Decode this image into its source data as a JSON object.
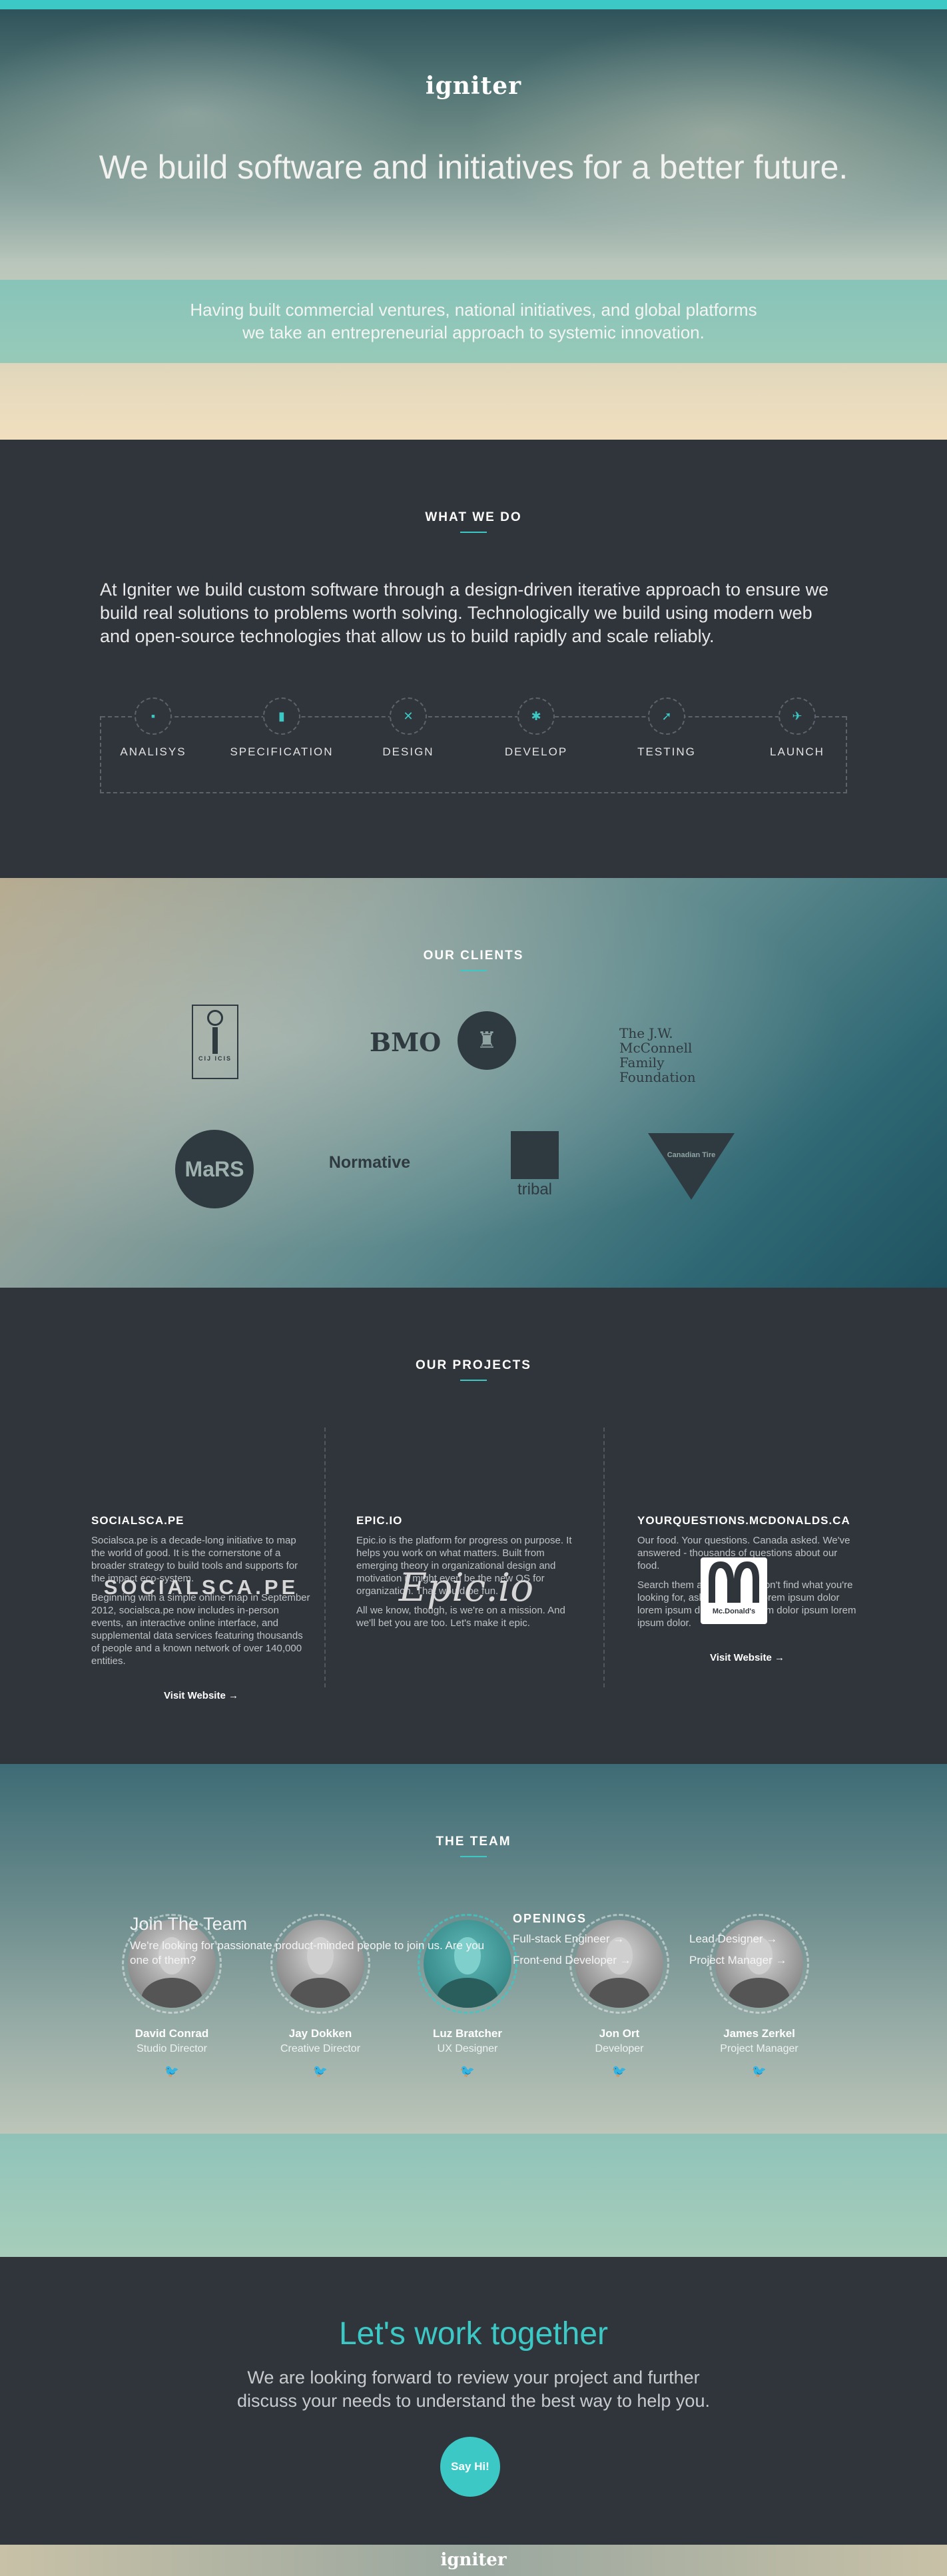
{
  "hero": {
    "logo": "igniter",
    "headline": "We build software and initiatives for a better future.",
    "sub_line1": "Having built commercial ventures, national initiatives, and global platforms",
    "sub_line2": "we take an entrepreneurial approach to systemic innovation."
  },
  "what_we_do": {
    "title": "WHAT WE DO",
    "lead": "At Igniter we build custom software through a design-driven iterative approach to ensure we build real solutions to problems worth solving. Technologically we build using modern web and open-source technologies that allow us to build rapidly and scale reliably.",
    "steps": [
      {
        "label": "ANALISYS",
        "icon": "video-icon"
      },
      {
        "label": "SPECIFICATION",
        "icon": "document-icon"
      },
      {
        "label": "DESIGN",
        "icon": "tools-icon"
      },
      {
        "label": "DEVELOP",
        "icon": "gear-icon"
      },
      {
        "label": "TESTING",
        "icon": "pointer-icon"
      },
      {
        "label": "LAUNCH",
        "icon": "plane-icon"
      }
    ]
  },
  "clients": {
    "title": "OUR CLIENTS",
    "logos": [
      {
        "name": "CIJ ICIS"
      },
      {
        "name": "BMO"
      },
      {
        "name": "The J.W. McConnell Family Foundation"
      },
      {
        "name": "MaRS"
      },
      {
        "name": "Normative"
      },
      {
        "name": "tribal"
      },
      {
        "name": "Canadian Tire"
      }
    ]
  },
  "projects": {
    "title": "OUR PROJECTS",
    "items": [
      {
        "logo": "SOCIALSCA.PE",
        "name": "SOCIALSCA.PE",
        "p1": "Socialsca.pe is a decade-long initiative to map the world of good. It is the cornerstone of a broader strategy to build tools and supports for the impact eco-system.",
        "p2": "Beginning with a simple online map in September 2012, socialsca.pe now includes in-person events, an interactive online interface, and supplemental data services featuring thousands of people and a known network of over 140,000 entities.",
        "link": "Visit Website →"
      },
      {
        "logo": "Epic.io",
        "name": "EPIC.IO",
        "p1": "Epic.io is the platform for progress on purpose. It helps you work on what matters. Built from emerging theory in organizational design and motivation it might even be the new OS for organization. That would be fun.",
        "p2": "All we know, though, is we're on a mission. And we'll bet you are too. Let's make it epic.",
        "link": ""
      },
      {
        "logo": "Mc.Donald's",
        "name": "YOURQUESTIONS.MCDONALDS.CA",
        "p1": "Our food. Your questions. Canada asked. We've answered - thousands of questions about our food.",
        "p2": "Search them all. And if you don't find what you're looking for, ask yours. And Lorem ipsum dolor lorem ipsum dolor lorem ipsum dolor ipsum lorem ipsum dolor.",
        "link": "Visit Website →"
      }
    ]
  },
  "team": {
    "title": "THE TEAM",
    "members": [
      {
        "name": "David Conrad",
        "role": "Studio Director"
      },
      {
        "name": "Jay Dokken",
        "role": "Creative Director"
      },
      {
        "name": "Luz Bratcher",
        "role": "UX Designer"
      },
      {
        "name": "Jon Ort",
        "role": "Developer"
      },
      {
        "name": "James Zerkel",
        "role": "Project Manager"
      }
    ],
    "join_title": "Join The Team",
    "join_desc": "We're looking for passionate product-minded people to join us. Are you one of them?",
    "openings_title": "OPENINGS",
    "openings": [
      "Full-stack Engineer →",
      "Lead Designer →",
      "Front-end Developer →",
      "Project Manager →"
    ]
  },
  "cta": {
    "title": "Let's work together",
    "line1": "We are looking forward to review your project and further",
    "line2": "discuss your needs to understand the best way to help you.",
    "button": "Say Hi!"
  },
  "footer": {
    "logo": "igniter"
  },
  "colors": {
    "accent": "#3cc9c6",
    "dark": "#30353c"
  }
}
